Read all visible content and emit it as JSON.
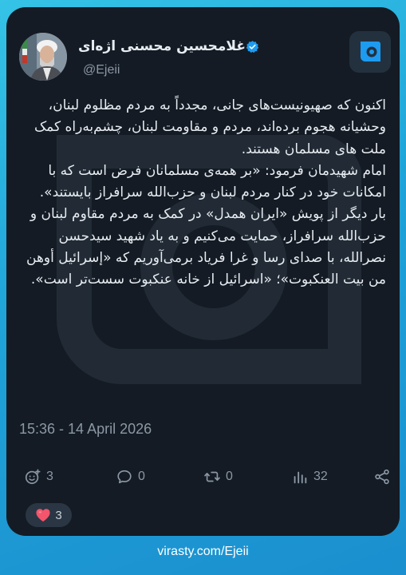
{
  "post": {
    "author_name": "غلامحسین محسنی اژه‌ای",
    "handle": "@Ejeii",
    "verified": true,
    "paragraphs": [
      "اکنون که صهیونیست‌های جانی، مجدداً به مردم مظلوم لبنان، وحشیانه هجوم برده‌اند، مردم و مقاومت لبنان، چشم‌به‌راه کمک ملت های مسلمان هستند.",
      "امام شهیدمان فرمود: «بر همه‌ی مسلمانان فرض است که با امکانات خود در کنار مردم لبنان و حزب‌الله سرافراز بایستند».",
      "بار دیگر از پویش «ایران همدل» در کمک به مردم مقاوم لبنان و حزب‌الله سرافراز، حمایت می‌کنیم و به یاد شهید سیدحسن نصرالله، با صدای رسا و غرا فریاد برمی‌آوریم که «إسرائیل أوهن من بیت العنکبوت»؛ «اسرائیل از خانه عنکبوت سست‌تر است»."
    ],
    "timestamp": "15:36 - 14 April 2026"
  },
  "actions": {
    "reactions_count": "3",
    "comments_count": "0",
    "reposts_count": "0",
    "views_count": "32"
  },
  "reaction_summary": {
    "count": "3"
  },
  "footer": {
    "link_text": "virasty.com/Ejeii"
  },
  "colors": {
    "background_top": "#35c3e6",
    "background_bottom": "#1b8fcf",
    "card": "#141b24",
    "verified_badge": "#1d9bf0",
    "heart": "#f2556c",
    "muted_text": "#8b98a5"
  },
  "icons": {
    "app_logo": "virasty-logo-icon",
    "verified": "verified-badge-icon",
    "reactions": "add-reaction-icon",
    "comments": "comment-icon",
    "reposts": "repost-icon",
    "views": "views-chart-icon",
    "share": "share-icon",
    "heart": "heart-icon"
  }
}
